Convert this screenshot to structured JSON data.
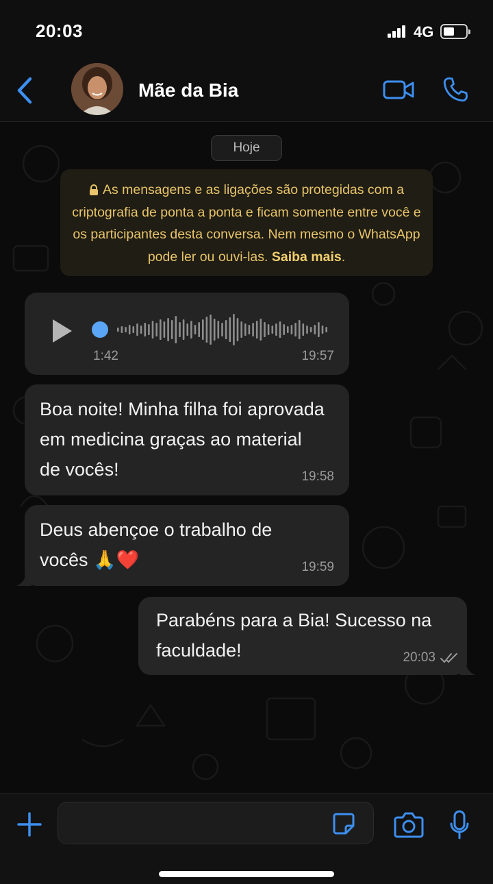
{
  "status_bar": {
    "time": "20:03",
    "network": "4G"
  },
  "header": {
    "contact_name": "Mãe da Bia"
  },
  "chat": {
    "date_chip": "Hoje",
    "encryption_notice": {
      "text": "As mensagens e as ligações são protegidas com a criptografia de ponta a ponta e ficam somente entre você e os participantes desta conversa. Nem mesmo o WhatsApp pode ler ou ouvi-las.",
      "link": "Saiba mais"
    },
    "messages": [
      {
        "type": "voice",
        "direction": "incoming",
        "duration": "1:42",
        "time": "19:57"
      },
      {
        "type": "text",
        "direction": "incoming",
        "text": "Boa noite! Minha filha foi aprovada em medicina graças ao material de vocês!",
        "time": "19:58"
      },
      {
        "type": "text",
        "direction": "incoming",
        "text": "Deus abençoe o trabalho de vocês 🙏❤️",
        "time": "19:59"
      },
      {
        "type": "text",
        "direction": "outgoing",
        "text": "Parabéns para a Bia! Sucesso na faculdade!",
        "time": "20:03",
        "status": "read"
      }
    ]
  },
  "colors": {
    "accent": "#3d8ff0",
    "notice_text": "#e9c46a",
    "bubble": "#242424",
    "voice_dot": "#5aa5f5"
  },
  "icons": [
    "back-chevron-icon",
    "video-call-icon",
    "phone-icon",
    "lock-icon",
    "play-icon",
    "double-check-icon",
    "plus-icon",
    "sticker-icon",
    "camera-icon",
    "microphone-icon"
  ]
}
